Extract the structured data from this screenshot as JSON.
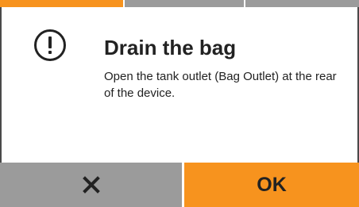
{
  "steps": [
    {
      "state": "active",
      "color": "#f7931e"
    },
    {
      "state": "inactive",
      "color": "#9b9b9b"
    },
    {
      "state": "inactive",
      "color": "#9b9b9b"
    }
  ],
  "dialog": {
    "icon": "exclamation-circle-icon",
    "title": "Drain the bag",
    "message": "Open the tank outlet (Bag Outlet) at the rear of the device."
  },
  "buttons": {
    "cancel_icon": "close-x-icon",
    "ok_label": "OK"
  },
  "colors": {
    "accent": "#f7931e",
    "cancel_bg": "#9b9b9b",
    "text": "#222222",
    "frame": "#4a4a4a"
  }
}
